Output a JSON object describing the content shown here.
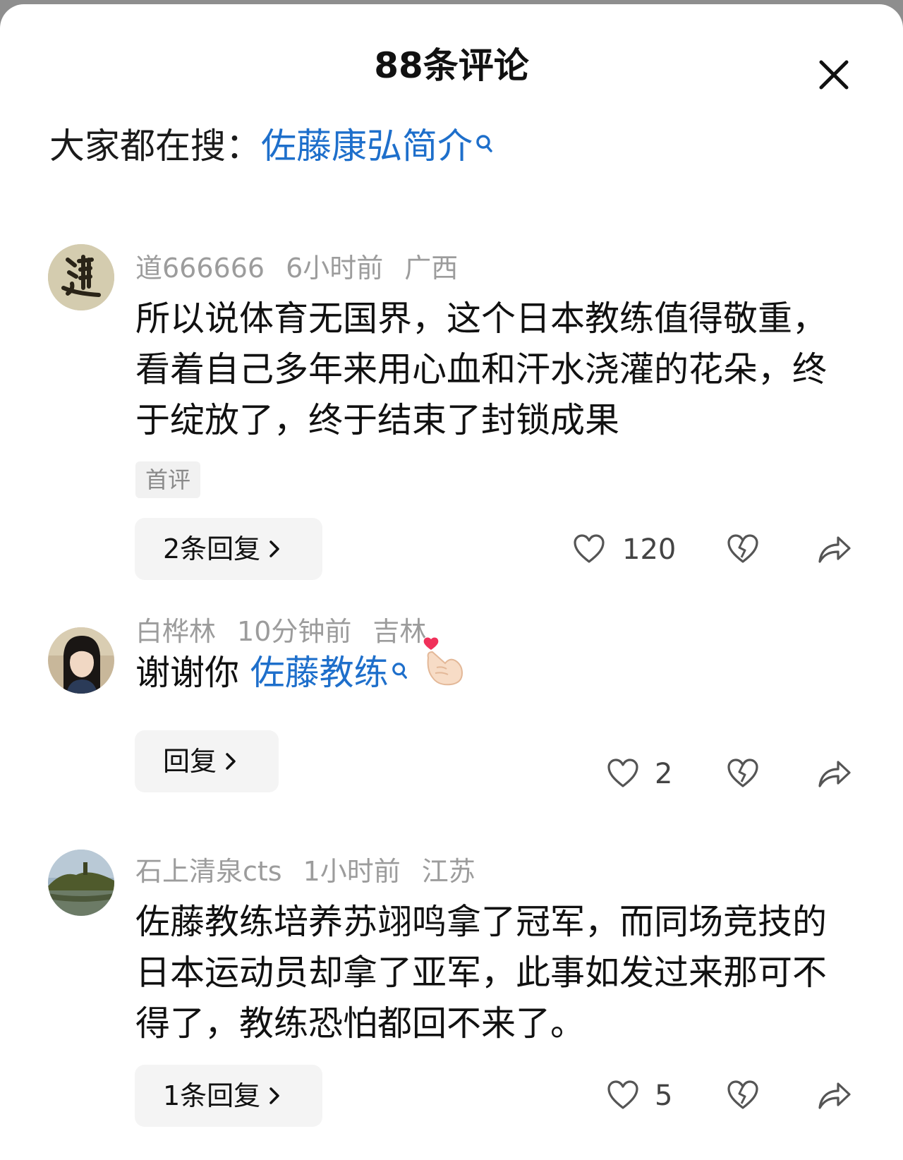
{
  "header": {
    "title": "88条评论"
  },
  "search": {
    "prefix": "大家都在搜：",
    "link": "佐藤康弘简介"
  },
  "comments": [
    {
      "username": "道666666",
      "time": "6小时前",
      "location": "广西",
      "avatar": "calligraphy-avatar",
      "text": "所以说体育无国界，这个日本教练值得敬重，看着自己多年来用心血和汗水浇灌的花朵，终于绽放了，终于结束了封锁成果",
      "tag": "首评",
      "reply_label": "2条回复",
      "likes": "120"
    },
    {
      "username": "白桦林",
      "time": "10分钟前",
      "location": "吉林",
      "avatar": "portrait-avatar",
      "text_prefix": "谢谢你 ",
      "text_link": "佐藤教练",
      "emoji": "finger-heart-emoji",
      "reply_label": "回复",
      "likes": "2"
    },
    {
      "username": "石上清泉cts",
      "time": "1小时前",
      "location": "江苏",
      "avatar": "landscape-avatar",
      "text": "佐藤教练培养苏翊鸣拿了冠军，而同场竞技的日本运动员却拿了亚军，此事如发过来那可不得了，教练恐怕都回不来了。",
      "reply_label": "1条回复",
      "likes": "5"
    }
  ],
  "colors": {
    "link": "#1e6fcb",
    "meta": "#9c9c9c",
    "button_bg": "#f4f4f4"
  }
}
